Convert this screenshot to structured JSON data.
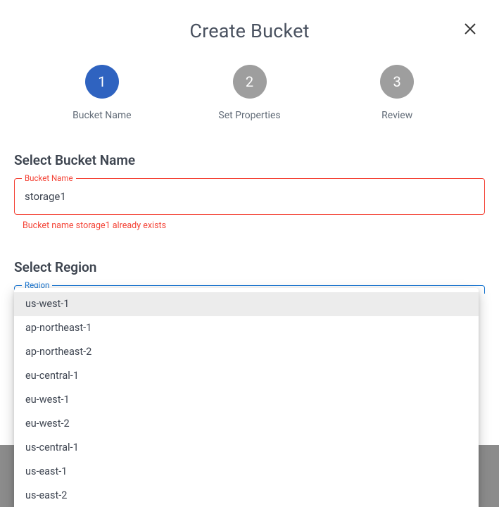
{
  "title": "Create Bucket",
  "steps": [
    {
      "num": "1",
      "label": "Bucket Name",
      "active": true
    },
    {
      "num": "2",
      "label": "Set Properties",
      "active": false
    },
    {
      "num": "3",
      "label": "Review",
      "active": false
    }
  ],
  "bucket_section": {
    "heading": "Select Bucket Name",
    "field_label": "Bucket Name",
    "value": "storage1",
    "error": "Bucket name storage1 already exists"
  },
  "region_section": {
    "heading": "Select Region",
    "field_label": "Region",
    "options": [
      "us-west-1",
      "ap-northeast-1",
      "ap-northeast-2",
      "eu-central-1",
      "eu-west-1",
      "eu-west-2",
      "us-central-1",
      "us-east-1",
      "us-east-2"
    ],
    "highlighted_index": 0
  }
}
